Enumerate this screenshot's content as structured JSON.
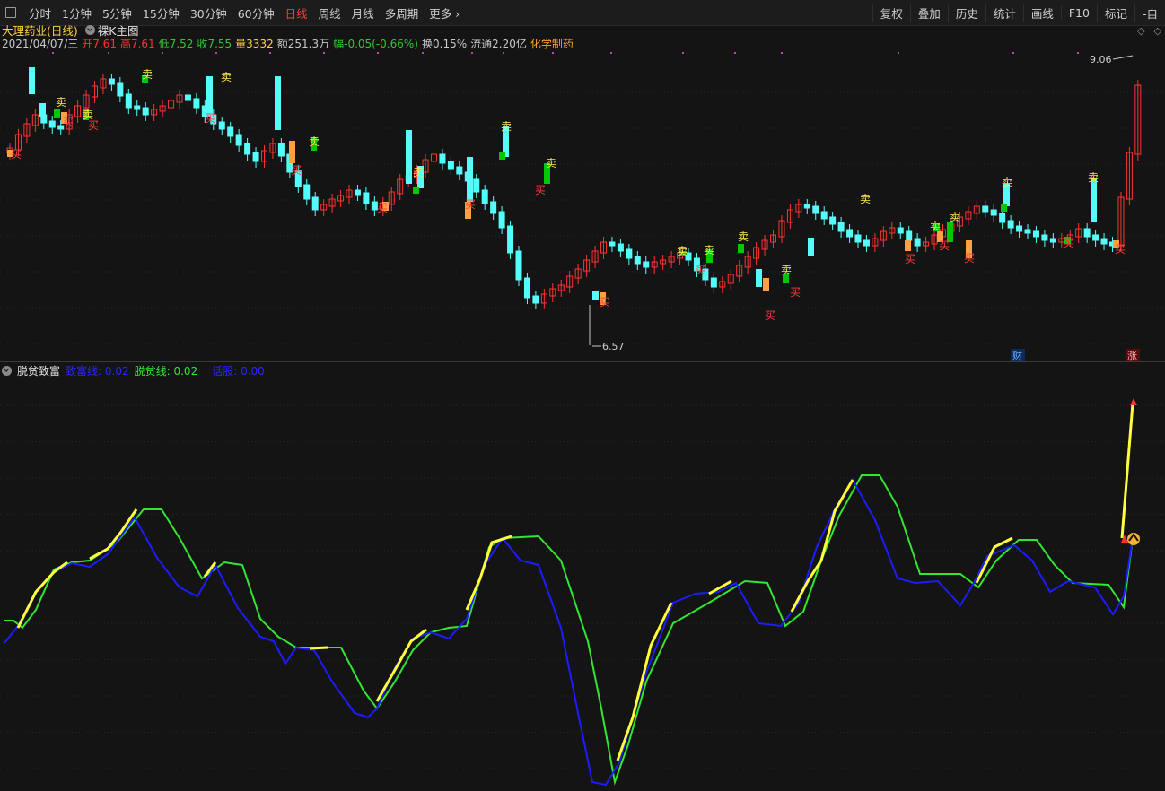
{
  "toolbar": {
    "periods": [
      "分时",
      "1分钟",
      "5分钟",
      "15分钟",
      "30分钟",
      "60分钟",
      "日线",
      "周线",
      "月线",
      "多周期",
      "更多"
    ],
    "active_index": 6,
    "right_items": [
      "复权",
      "叠加",
      "历史",
      "统计",
      "画线",
      "F10",
      "标记",
      "-自"
    ]
  },
  "stock": {
    "name": "大理药业",
    "period": "(日线)",
    "chart_mode": "裸K主图",
    "date": "2021/04/07/三",
    "open_label": "开",
    "open": "7.61",
    "high_label": "高",
    "high": "7.61",
    "low_label": "低",
    "low": "7.52",
    "close_label": "收",
    "close": "7.55",
    "vol_label": "量",
    "vol": "3332",
    "amount_label": "额",
    "amount": "251.3万",
    "change_label": "幅",
    "change": "-0.05(-0.66%)",
    "turnover_label": "换",
    "turnover": "0.15%",
    "float_label": "流通",
    "float_cap": "2.20亿",
    "industry": "化学制药"
  },
  "price_labels": {
    "max": "9.06",
    "min": "6.57"
  },
  "signals": {
    "buy": "买",
    "sell": "卖",
    "finance": "财",
    "limit_up": "涨"
  },
  "indicator": {
    "name": "脱贫致富",
    "line1_label": "致富线:",
    "line1_value": "0.02",
    "line2_label": "脱贫线:",
    "line2_value": "0.02",
    "line3_label": "话股:",
    "line3_value": "0.00"
  },
  "colors": {
    "up": "#ff3232",
    "down": "#54fcfc",
    "sell_bar": "#00c800",
    "buy_bar": "#ffa040",
    "fast_line": "#1c1cff",
    "slow_line": "#32e632",
    "highlight": "#ffff3c"
  }
}
